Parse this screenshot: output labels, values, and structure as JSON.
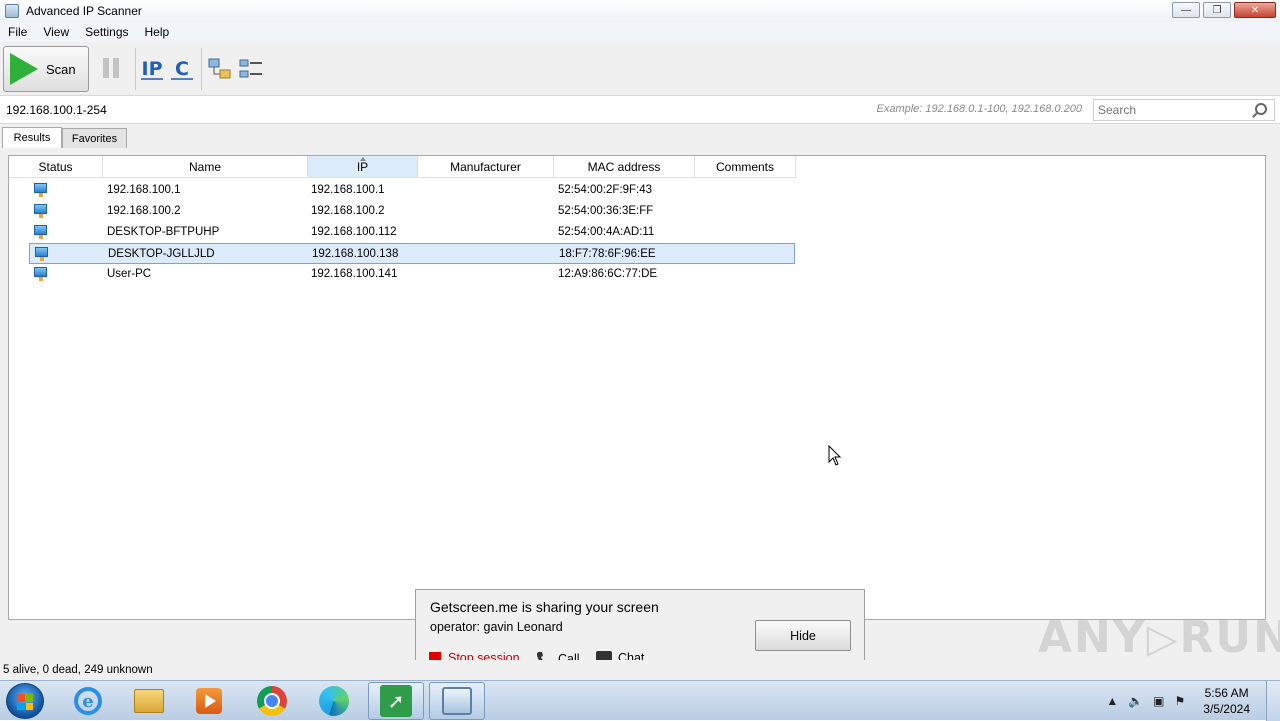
{
  "window": {
    "title": "Advanced IP Scanner"
  },
  "menu": [
    "File",
    "View",
    "Settings",
    "Help"
  ],
  "toolbar": {
    "scan_label": "Scan",
    "scan_icon": "play-icon",
    "pause_icon": "pause-icon",
    "ip_label": "IP",
    "c_label": "C",
    "accent_color": "#2fb03a"
  },
  "address": {
    "value": "192.168.100.1-254",
    "example": "Example: 192.168.0.1-100, 192.168.0.200"
  },
  "search": {
    "placeholder": "Search"
  },
  "tabs": [
    "Results",
    "Favorites"
  ],
  "table": {
    "columns": [
      "Status",
      "Name",
      "IP",
      "Manufacturer",
      "MAC address",
      "Comments"
    ],
    "sorted_column": "IP",
    "rows": [
      {
        "name": "192.168.100.1",
        "ip": "192.168.100.1",
        "manufacturer": "",
        "mac": "52:54:00:2F:9F:43",
        "comments": "",
        "selected": false
      },
      {
        "name": "192.168.100.2",
        "ip": "192.168.100.2",
        "manufacturer": "",
        "mac": "52:54:00:36:3E:FF",
        "comments": "",
        "selected": false
      },
      {
        "name": "DESKTOP-BFTPUHP",
        "ip": "192.168.100.112",
        "manufacturer": "",
        "mac": "52:54:00:4A:AD:11",
        "comments": "",
        "selected": false
      },
      {
        "name": "DESKTOP-JGLLJLD",
        "ip": "192.168.100.138",
        "manufacturer": "",
        "mac": "18:F7:78:6F:96:EE",
        "comments": "",
        "selected": true
      },
      {
        "name": "User-PC",
        "ip": "192.168.100.141",
        "manufacturer": "",
        "mac": "12:A9:86:6C:77:DE",
        "comments": "",
        "selected": false
      }
    ]
  },
  "popup": {
    "title": "Getscreen.me is sharing your screen",
    "operator": "operator: gavin Leonard",
    "hide_label": "Hide",
    "stop_label": "Stop session",
    "call_label": "Call",
    "chat_label": "Chat"
  },
  "status": {
    "text": "5 alive, 0 dead, 249 unknown"
  },
  "watermark": "ANY RUN",
  "taskbar": {
    "apps": [
      "internet-explorer-icon",
      "file-explorer-icon",
      "media-player-icon",
      "chrome-icon",
      "edge-icon",
      "getscreen-icon",
      "ip-scanner-icon"
    ],
    "time": "5:56 AM",
    "date": "3/5/2024"
  }
}
